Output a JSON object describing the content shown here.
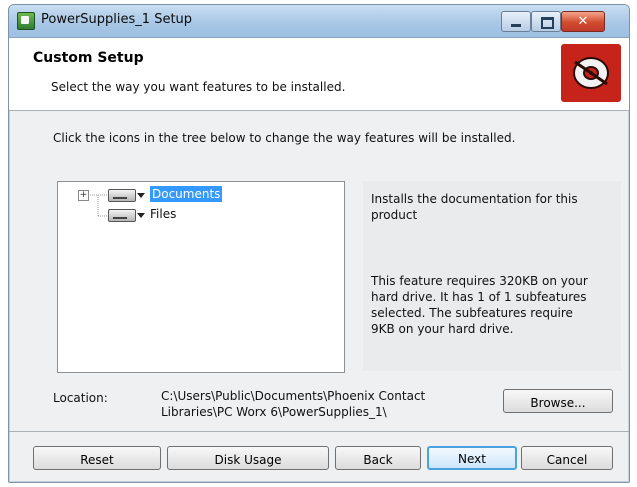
{
  "window": {
    "title": "PowerSupplies_1 Setup"
  },
  "header": {
    "title": "Custom Setup",
    "subtitle": "Select the way you want features to be installed."
  },
  "instruction": "Click the icons in the tree below to change the way features will be installed.",
  "tree": {
    "items": [
      {
        "label": "Documents",
        "selected": true,
        "expander": "+"
      },
      {
        "label": "Files",
        "selected": false
      }
    ]
  },
  "description": {
    "summary": "Installs the documentation for this product",
    "requirements": "This feature requires 320KB on your hard drive. It has 1 of 1 subfeatures selected. The subfeatures require 9KB on your hard drive."
  },
  "location": {
    "label": "Location:",
    "path": "C:\\Users\\Public\\Documents\\Phoenix Contact Libraries\\PC Worx 6\\PowerSupplies_1\\"
  },
  "buttons": {
    "browse": "Browse...",
    "reset": "Reset",
    "disk_usage": "Disk Usage",
    "back": "Back",
    "next": "Next",
    "cancel": "Cancel"
  },
  "colors": {
    "selection": "#3399ff",
    "logo_bg": "#c6241b",
    "default_button_border": "#4aa3df"
  },
  "icons": {
    "app": "installer-icon",
    "logo": "disc-logo-icon",
    "feature": "drive-dropdown-icon"
  }
}
